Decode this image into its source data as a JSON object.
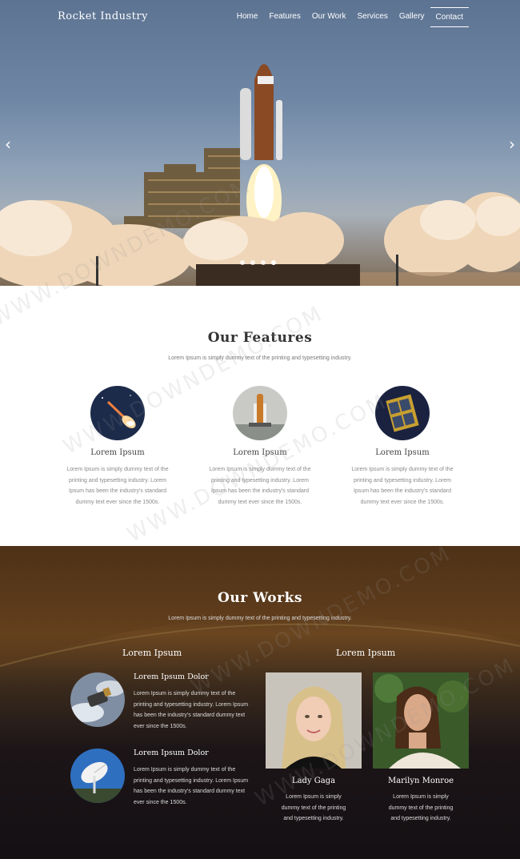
{
  "header": {
    "brand": "Rocket Industry",
    "nav": [
      {
        "label": "Home"
      },
      {
        "label": "Features"
      },
      {
        "label": "Our Work"
      },
      {
        "label": "Services"
      },
      {
        "label": "Gallery"
      },
      {
        "label": "Contact",
        "active": true
      }
    ]
  },
  "slider": {
    "prev_icon": "‹",
    "next_icon": "›",
    "slide_count": 4,
    "active_slide": 4
  },
  "features": {
    "title": "Our Features",
    "subtitle": "Lorem Ipsum is simply dummy text of the printing and typesetting industry.",
    "items": [
      {
        "icon": "rocket-launch-image",
        "heading": "Lorem Ipsum",
        "text": "Lorem Ipsum is simply dummy text of the printing and typesetting industry. Lorem Ipsum has been the industry's standard dummy text ever since the 1500s."
      },
      {
        "icon": "space-shuttle-image",
        "heading": "Lorem Ipsum",
        "text": "Lorem Ipsum is simply dummy text of the printing and typesetting industry. Lorem Ipsum has been the industry's standard dummy text ever since the 1500s."
      },
      {
        "icon": "satellite-image",
        "heading": "Lorem Ipsum",
        "text": "Lorem Ipsum is simply dummy text of the printing and typesetting industry. Lorem Ipsum has been the industry's standard dummy text ever since the 1500s."
      }
    ]
  },
  "works": {
    "title": "Our Works",
    "subtitle": "Lorem Ipsum is simply dummy text of the printing and typesetting industry.",
    "left_heading": "Lorem Ipsum",
    "right_heading": "Lorem Ipsum",
    "items": [
      {
        "icon": "space-probe-image",
        "heading": "Lorem Ipsum Dolor",
        "text": "Lorem Ipsum is simply dummy text of the printing and typesetting industry. Lorem Ipsum has been the industry's standard dummy text ever since the 1500s."
      },
      {
        "icon": "radio-dish-image",
        "heading": "Lorem Ipsum Dolor",
        "text": "Lorem Ipsum is simply dummy text of the printing and typesetting industry. Lorem Ipsum has been the industry's standard dummy text ever since the 1500s."
      }
    ],
    "people": [
      {
        "name": "Lady Gaga",
        "text": "Lorem Ipsum is simply dummy text of the printing and typesetting industry."
      },
      {
        "name": "Marilyn Monroe",
        "text": "Lorem Ipsum is simply dummy text of the printing and typesetting industry."
      }
    ]
  },
  "watermark": "WWW.DOWNDEMO.COM"
}
